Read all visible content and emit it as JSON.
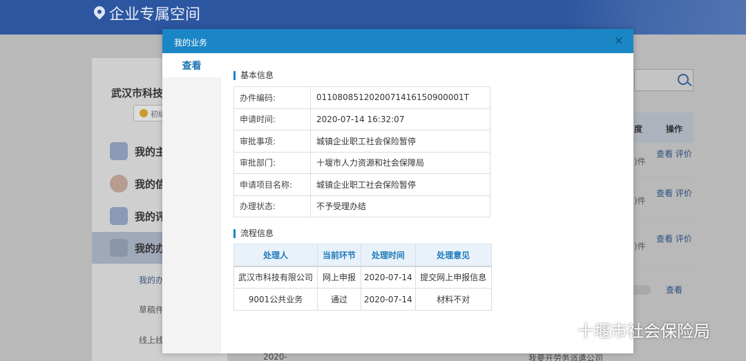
{
  "header": {
    "title": "企业专属空间"
  },
  "sidebar": {
    "company": "武汉市科技",
    "level": "初级",
    "items": [
      {
        "label": "我的主"
      },
      {
        "label": "我的信"
      },
      {
        "label": "我的评"
      },
      {
        "label": "我的办"
      }
    ],
    "sub_items": [
      {
        "label": "我的办"
      },
      {
        "label": "草稿件"
      },
      {
        "label": "线上线"
      }
    ]
  },
  "background_table": {
    "headers": [
      "度",
      "操作"
    ],
    "rows": [
      {
        "status": ")件",
        "action": "查看 评价"
      },
      {
        "status": ")件",
        "action": "查看 评价"
      },
      {
        "status": ")件",
        "action": "查看 评价"
      },
      {
        "status": "",
        "action": "查看"
      }
    ],
    "bottom_date": "2020-",
    "bottom_text": "我要开劳务派遣公司"
  },
  "modal": {
    "title": "我的业务",
    "close": "×",
    "tab": "查看",
    "basic_section": "基本信息",
    "basic": [
      {
        "key": "办件编码:",
        "value": "011080851202007141615090 0001T"
      },
      {
        "key": "申请时间:",
        "value": "2020-07-14 16:32:07"
      },
      {
        "key": "审批事项:",
        "value": "城镇企业职工社会保险暂停"
      },
      {
        "key": "审批部门:",
        "value": "十堰市人力资源和社会保障局"
      },
      {
        "key": "申请项目名称:",
        "value": "城镇企业职工社会保险暂停"
      },
      {
        "key": "办理状态:",
        "value": "不予受理办结"
      }
    ],
    "process_section": "流程信息",
    "process_headers": [
      "处理人",
      "当前环节",
      "处理时间",
      "处理意见"
    ],
    "process_rows": [
      [
        "武汉市科技有限公司",
        "网上申报",
        "2020-07-14",
        "提交网上申报信息"
      ],
      [
        "9001公共业务",
        "通过",
        "2020-07-14",
        "材料不对"
      ]
    ]
  },
  "watermark": {
    "text": "十堰市社会保险局"
  }
}
